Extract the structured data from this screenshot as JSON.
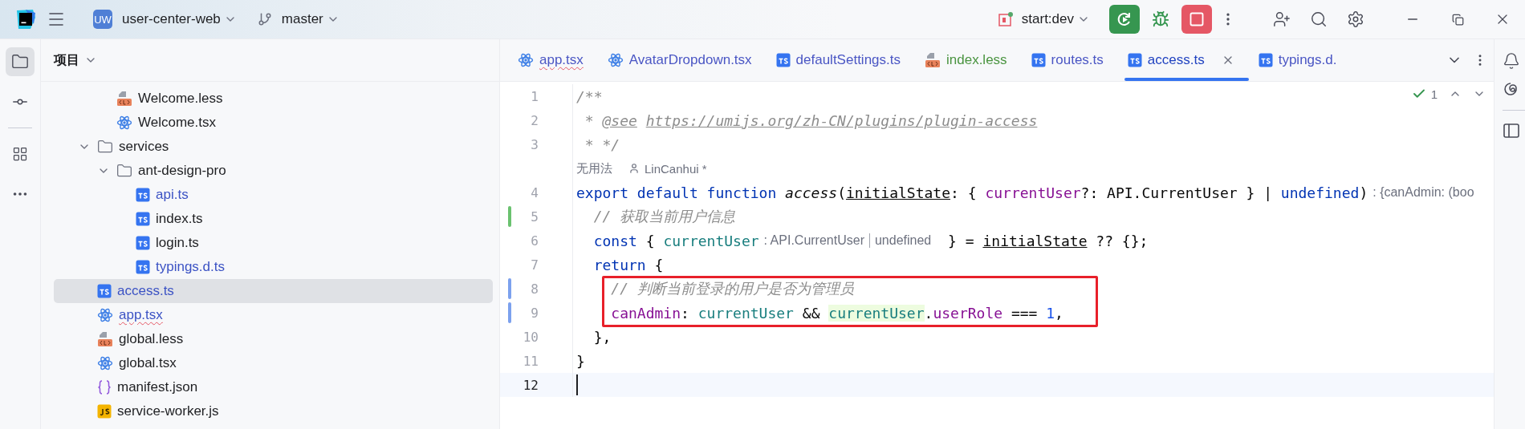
{
  "title_bar": {
    "project_badge": "UW",
    "project": "user-center-web",
    "branch": "master",
    "run_config": "start:dev"
  },
  "left_toolbar": [
    {
      "kind": "folder",
      "selected": true
    },
    {
      "kind": "commit",
      "selected": false
    },
    {
      "kind": "structure",
      "selected": false
    },
    {
      "kind": "more",
      "selected": false
    }
  ],
  "project_panel": {
    "title": "项目",
    "tree": [
      {
        "children": [
          {
            "label": "Welcome.less",
            "kind": "less",
            "color": "#1e1f22",
            "error": false,
            "selected": false
          },
          {
            "label": "Welcome.tsx",
            "kind": "tsx",
            "color": "#1e1f22",
            "error": false,
            "selected": false
          }
        ]
      },
      {
        "label": "services",
        "kind": "folder",
        "color": "#1e1f22",
        "error": false,
        "selected": false,
        "expanded": true,
        "children": [
          {
            "label": "ant-design-pro",
            "kind": "folder",
            "color": "#1e1f22",
            "error": false,
            "selected": false,
            "expanded": true,
            "children": [
              {
                "label": "api.ts",
                "kind": "ts",
                "color": "#3b52c4",
                "error": false,
                "selected": false
              },
              {
                "label": "index.ts",
                "kind": "ts",
                "color": "#1e1f22",
                "error": false,
                "selected": false
              },
              {
                "label": "login.ts",
                "kind": "ts",
                "color": "#1e1f22",
                "error": false,
                "selected": false
              },
              {
                "label": "typings.d.ts",
                "kind": "ts",
                "color": "#3b52c4",
                "error": false,
                "selected": false
              }
            ]
          }
        ]
      },
      {
        "label": "access.ts",
        "kind": "ts",
        "color": "#3b52c4",
        "error": false,
        "selected": true
      },
      {
        "label": "app.tsx",
        "kind": "tsx",
        "color": "#3b52c4",
        "error": true,
        "selected": false
      },
      {
        "label": "global.less",
        "kind": "less",
        "color": "#1e1f22",
        "error": false,
        "selected": false
      },
      {
        "label": "global.tsx",
        "kind": "tsx",
        "color": "#1e1f22",
        "error": false,
        "selected": false
      },
      {
        "label": "manifest.json",
        "kind": "json",
        "color": "#1e1f22",
        "error": false,
        "selected": false
      },
      {
        "label": "service-worker.js",
        "kind": "js",
        "color": "#1e1f22",
        "error": false,
        "selected": false
      }
    ]
  },
  "tabs": [
    {
      "label": "app.tsx",
      "kind": "tsx",
      "color": "#4a56c4",
      "error": true,
      "selected": false
    },
    {
      "label": "AvatarDropdown.tsx",
      "kind": "tsx",
      "color": "#4a56c4",
      "error": false,
      "selected": false
    },
    {
      "label": "defaultSettings.ts",
      "kind": "ts",
      "color": "#4a56c4",
      "error": false,
      "selected": false
    },
    {
      "label": "index.less",
      "kind": "less",
      "color": "#4a9440",
      "error": false,
      "selected": false
    },
    {
      "label": "routes.ts",
      "kind": "ts",
      "color": "#4a56c4",
      "error": false,
      "selected": false
    },
    {
      "label": "access.ts",
      "kind": "ts",
      "color": "#2042c0",
      "error": false,
      "selected": true
    },
    {
      "label": "typings.d.",
      "kind": "ts",
      "color": "#4a56c4",
      "error": false,
      "selected": false
    }
  ],
  "editor": {
    "inspection_count": "1",
    "lines": [
      {
        "kind": "code",
        "number": "1",
        "boxed": false,
        "current": false,
        "tokens": [
          {
            "text": "/**",
            "kind": "comment"
          }
        ]
      },
      {
        "kind": "code",
        "number": "2",
        "boxed": false,
        "current": false,
        "tokens": [
          {
            "text": " * ",
            "kind": "comment"
          },
          {
            "text": "@see",
            "kind": "doctag"
          },
          {
            "text": "https://umijs.org/zh-CN/plugins/plugin-access",
            "kind": "link"
          }
        ]
      },
      {
        "kind": "code",
        "number": "3",
        "boxed": false,
        "current": false,
        "tokens": [
          {
            "text": " * */",
            "kind": "comment"
          }
        ]
      },
      {
        "kind": "vision",
        "usages": "无用法",
        "author": "LinCanhui *"
      },
      {
        "kind": "code",
        "number": "4",
        "boxed": false,
        "current": false,
        "tokens": [
          {
            "text": "export default function ",
            "kind": "keyword"
          },
          {
            "text": "access",
            "kind": "fn"
          },
          {
            "text": "(",
            "kind": "plain"
          },
          {
            "text": "initialState",
            "kind": "param"
          },
          {
            "text": ": { ",
            "kind": "plain"
          },
          {
            "text": "currentUser",
            "kind": "field"
          },
          {
            "text": "?: API.CurrentUser } | ",
            "kind": "plain"
          },
          {
            "text": "undefined",
            "kind": "keyword"
          },
          {
            "text": ")",
            "kind": "plain"
          },
          {
            "text": ": {canAdmin: (boo",
            "kind": "hint"
          }
        ]
      },
      {
        "kind": "code",
        "number": "5",
        "color": "#6ac26f",
        "boxed": false,
        "current": false,
        "tokens": [
          {
            "text": "  // 获取当前用户信息",
            "kind": "comment"
          }
        ]
      },
      {
        "kind": "code",
        "number": "6",
        "boxed": false,
        "current": false,
        "tokens": [
          {
            "text": "  const",
            "kind": "keyword"
          },
          {
            "text": " { ",
            "kind": "plain"
          },
          {
            "text": "currentUser",
            "kind": "local"
          },
          {
            "text": ": API.CurrentUser",
            "kind": "hint"
          },
          {
            "text": "undefined",
            "kind": "hint-union"
          },
          {
            "text": " } = ",
            "kind": "plain"
          },
          {
            "text": "initialState",
            "kind": "param"
          },
          {
            "text": " ?? {};",
            "kind": "plain"
          }
        ]
      },
      {
        "kind": "code",
        "number": "7",
        "boxed": false,
        "current": false,
        "tokens": [
          {
            "text": "  return",
            "kind": "keyword"
          },
          {
            "text": " {",
            "kind": "plain"
          }
        ]
      },
      {
        "kind": "code",
        "number": "8",
        "color": "#7ca1ee",
        "boxed": true,
        "current": false,
        "tokens": [
          {
            "text": "    // 判断当前登录的用户是否为管理员",
            "kind": "comment"
          }
        ]
      },
      {
        "kind": "code",
        "number": "9",
        "color": "#7ca1ee",
        "boxed": true,
        "current": false,
        "tokens": [
          {
            "text": "    canAdmin",
            "kind": "field"
          },
          {
            "text": ": ",
            "kind": "plain"
          },
          {
            "text": "currentUser",
            "kind": "local"
          },
          {
            "text": " && ",
            "kind": "plain"
          },
          {
            "text": "currentUser",
            "kind": "local-hl"
          },
          {
            "text": ".",
            "kind": "plain"
          },
          {
            "text": "userRole",
            "kind": "field"
          },
          {
            "text": " === ",
            "kind": "plain"
          },
          {
            "text": "1",
            "kind": "number"
          },
          {
            "text": ",",
            "kind": "plain"
          }
        ]
      },
      {
        "kind": "code",
        "number": "10",
        "boxed": false,
        "current": false,
        "tokens": [
          {
            "text": "  },",
            "kind": "plain"
          }
        ]
      },
      {
        "kind": "code",
        "number": "11",
        "boxed": false,
        "current": false,
        "tokens": [
          {
            "text": "}",
            "kind": "plain"
          }
        ]
      },
      {
        "kind": "code",
        "number": "12",
        "boxed": false,
        "current": true
      }
    ]
  }
}
